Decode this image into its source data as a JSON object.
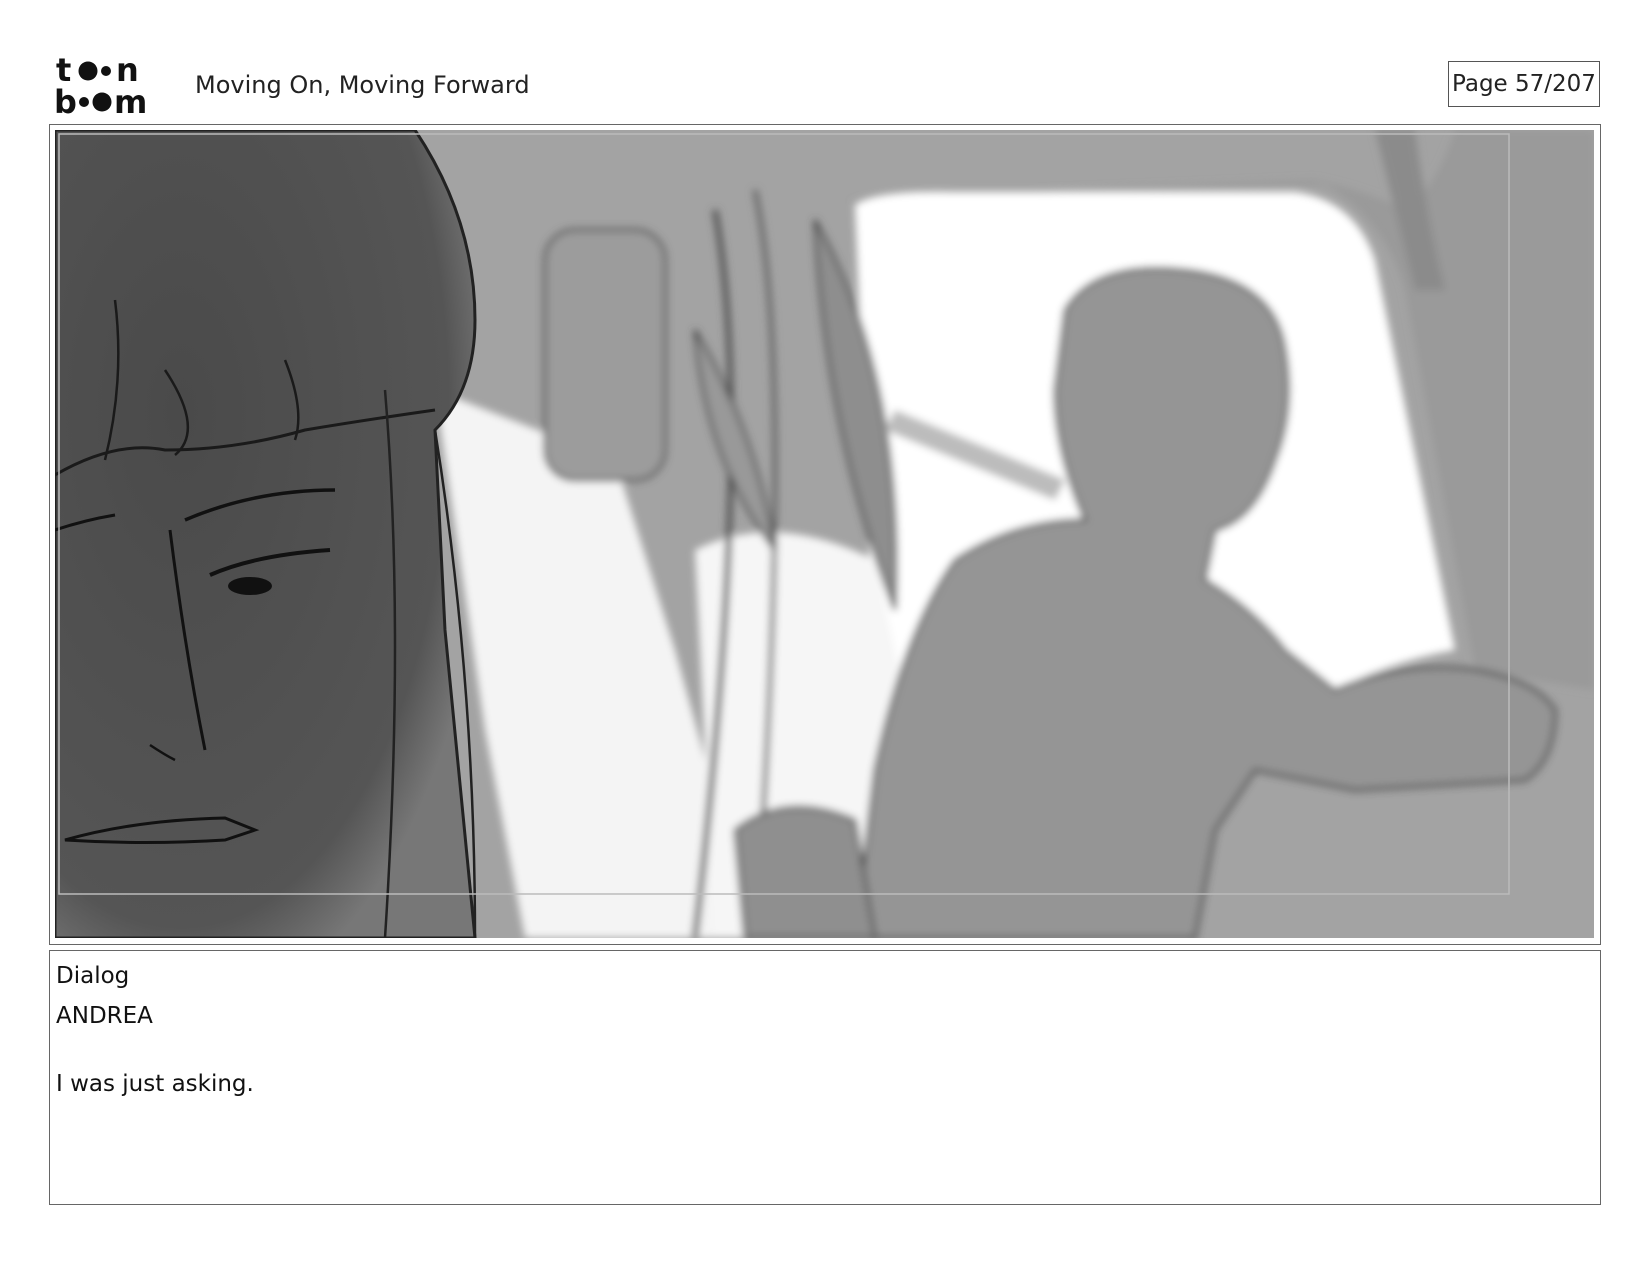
{
  "header": {
    "logo_text": "toon boom",
    "document_title": "Moving On, Moving Forward",
    "page_indicator": "Page  57/207"
  },
  "panel": {
    "image_icon": "storyboard-sketch-car-interior"
  },
  "dialog": {
    "header": "Dialog",
    "speaker": "ANDREA",
    "line": "I was just asking."
  }
}
